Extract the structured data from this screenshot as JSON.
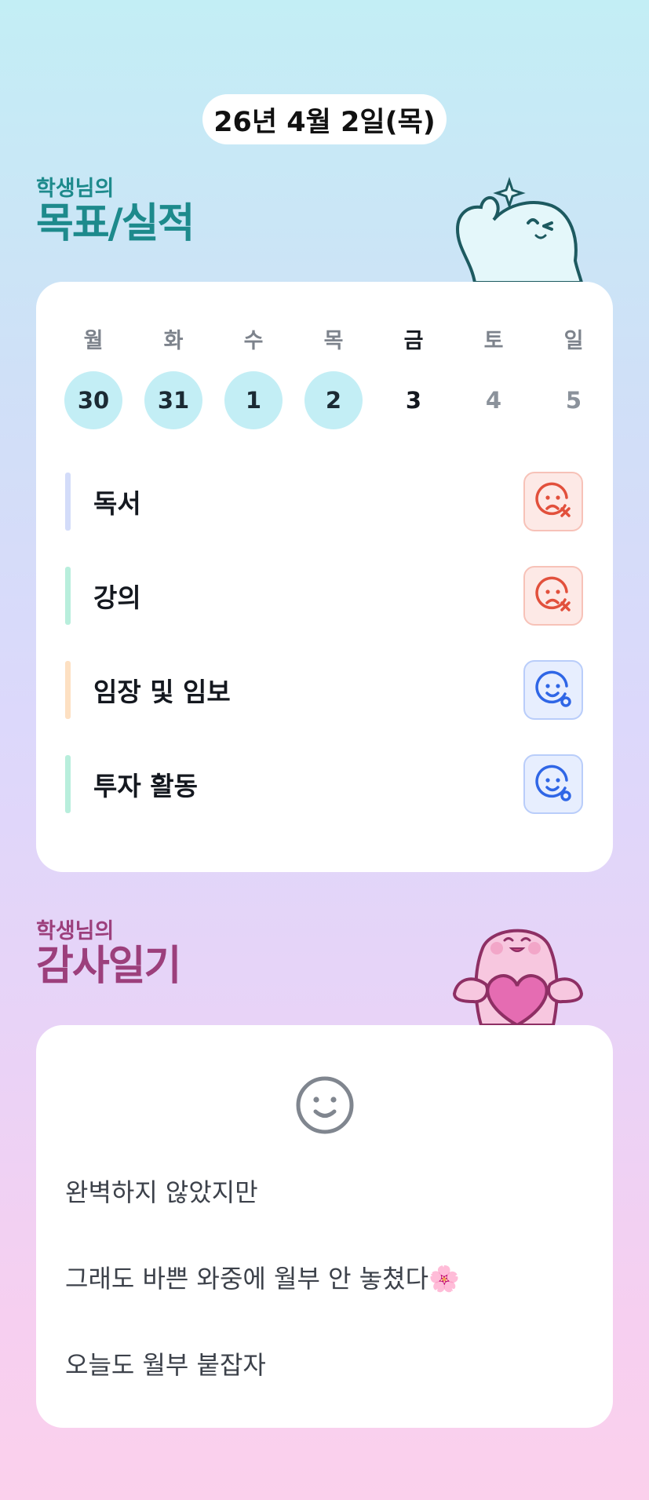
{
  "date_label": "26년 4월 2일(목)",
  "goals_section": {
    "subtitle": "학생님의",
    "title": "목표/실적"
  },
  "week": {
    "days": [
      {
        "name": "월",
        "num": "30",
        "state": "done"
      },
      {
        "name": "화",
        "num": "31",
        "state": "done"
      },
      {
        "name": "수",
        "num": "1",
        "state": "done"
      },
      {
        "name": "목",
        "num": "2",
        "state": "done"
      },
      {
        "name": "금",
        "num": "3",
        "state": "current"
      },
      {
        "name": "토",
        "num": "4",
        "state": "future"
      },
      {
        "name": "일",
        "num": "5",
        "state": "future"
      }
    ]
  },
  "goals": [
    {
      "label": "독서",
      "status": "fail",
      "bar_color": "#d3dcf9"
    },
    {
      "label": "강의",
      "status": "fail",
      "bar_color": "#b8eedc"
    },
    {
      "label": "임장 및 임보",
      "status": "ok",
      "bar_color": "#fde0c2"
    },
    {
      "label": "투자 활동",
      "status": "ok",
      "bar_color": "#b8eedc"
    }
  ],
  "diary_section": {
    "subtitle": "학생님의",
    "title": "감사일기"
  },
  "diary": {
    "mood_icon": "smile-face-icon",
    "lines": [
      "완벽하지 않았지만",
      "그래도 바쁜 와중에 월부 안 놓쳤다🌸",
      "오늘도 월부 붙잡자"
    ]
  },
  "colors": {
    "teal": "#1d8a8c",
    "purple": "#9c3f7c",
    "fail": "#e2503c",
    "ok": "#2f66e6",
    "done_circle": "#c3eef5"
  }
}
